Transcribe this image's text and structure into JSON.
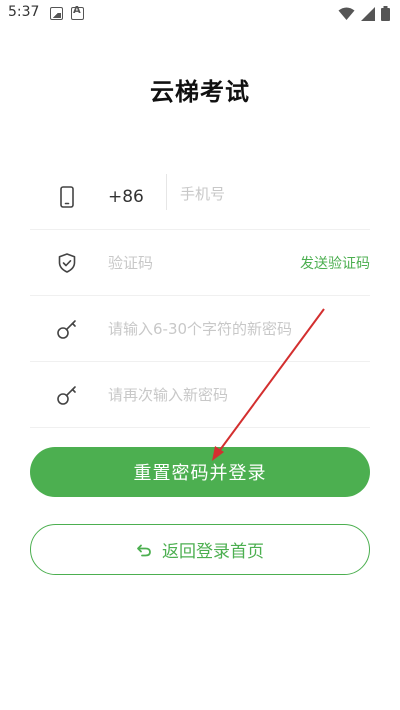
{
  "status_bar": {
    "time": "5:37",
    "notification_icons": [
      "image-icon",
      "font-icon"
    ],
    "system_icons": [
      "wifi-icon",
      "signal-icon",
      "battery-icon"
    ]
  },
  "app": {
    "title": "云梯考试"
  },
  "form": {
    "phone": {
      "icon": "phone-icon",
      "country_code": "+86",
      "placeholder": "手机号",
      "value": ""
    },
    "verification_code": {
      "icon": "shield-check-icon",
      "placeholder": "验证码",
      "value": "",
      "send_label": "发送验证码"
    },
    "new_password": {
      "icon": "key-icon",
      "placeholder": "请输入6-30个字符的新密码",
      "value": ""
    },
    "confirm_password": {
      "icon": "key-icon",
      "placeholder": "请再次输入新密码",
      "value": ""
    }
  },
  "actions": {
    "reset_label": "重置密码并登录",
    "back_label": "返回登录首页",
    "back_icon": "undo-icon"
  },
  "colors": {
    "accent": "#4caf50",
    "placeholder": "#c8c8c8",
    "annotation_arrow": "#d32f2f"
  }
}
